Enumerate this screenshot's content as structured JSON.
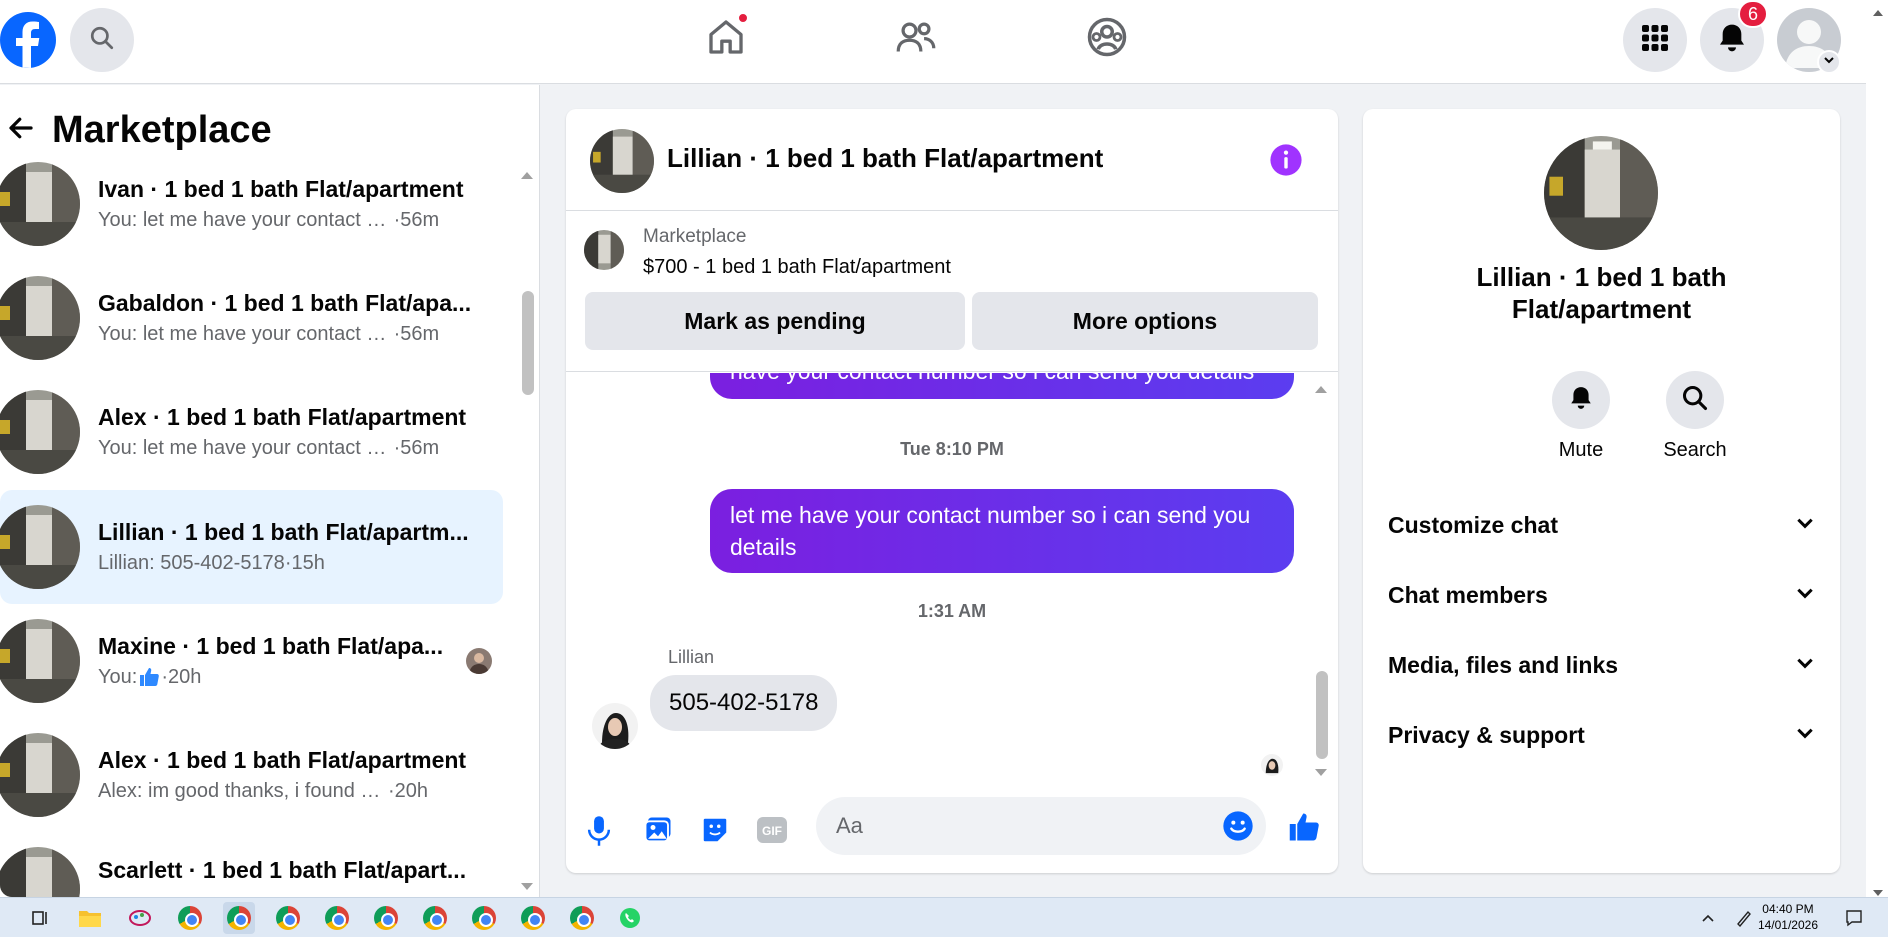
{
  "topbar": {
    "notifications_count": "6",
    "icons": [
      "facebook-logo",
      "search-icon",
      "home-icon",
      "friends-icon",
      "groups-icon",
      "apps-grid-icon",
      "bell-icon",
      "profile-avatar"
    ]
  },
  "left": {
    "title": "Marketplace",
    "conversations": [
      {
        "name": "Ivan · 1 bed 1 bath Flat/apartment",
        "msg": "You: let me have your contact nu...",
        "time": "·56m"
      },
      {
        "name": "Gabaldon · 1 bed 1 bath Flat/apa...",
        "msg": "You: let me have your contact nu...",
        "time": "·56m"
      },
      {
        "name": "Alex · 1 bed 1 bath Flat/apartment",
        "msg": "You: let me have your contact nu...",
        "time": "·56m"
      },
      {
        "name": "Lillian · 1 bed 1 bath Flat/apartm...",
        "msg": "Lillian: 505-402-5178",
        "time": "·15h"
      },
      {
        "name": "Maxine · 1 bed 1 bath Flat/apa...",
        "msg": "You: ",
        "time": "·20h"
      },
      {
        "name": "Alex · 1 bed 1 bath Flat/apartment",
        "msg": "Alex: im good thanks, i found a pl...",
        "time": "·20h"
      },
      {
        "name": "Scarlett · 1 bed 1 bath Flat/apart...",
        "msg": "",
        "time": ""
      }
    ]
  },
  "chat": {
    "title": "Lillian · 1 bed 1 bath Flat/apartment",
    "listing_source": "Marketplace",
    "listing_title": "$700 - 1 bed 1 bath Flat/apartment",
    "mark_pending": "Mark as pending",
    "more_options": "More options",
    "partial_msg": "have your contact number so i can send you details",
    "ts1": "Tue 8:10 PM",
    "out_msg": "let me have your contact number so i can send you details",
    "ts2": "1:31 AM",
    "sender": "Lillian",
    "in_msg": "505-402-5178",
    "input_placeholder": "Aa"
  },
  "right": {
    "title": "Lillian · 1 bed 1 bath Flat/apartment",
    "mute": "Mute",
    "search": "Search",
    "sections": [
      "Customize chat",
      "Chat members",
      "Media, files and links",
      "Privacy & support"
    ]
  },
  "taskbar": {
    "time": "04:40 PM",
    "date": "14/01/2026"
  },
  "colors": {
    "facebook_blue": "#0866ff",
    "messenger_purple": "#7b1fe0",
    "selected_bg": "#e7f3ff",
    "badge_red": "#e41e3f"
  }
}
